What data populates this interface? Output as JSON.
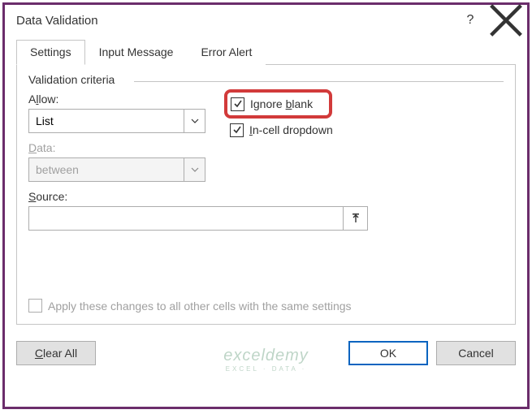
{
  "titlebar": {
    "title": "Data Validation"
  },
  "tabs": [
    {
      "label": "Settings",
      "active": true
    },
    {
      "label": "Input Message",
      "active": false
    },
    {
      "label": "Error Alert",
      "active": false
    }
  ],
  "criteria": {
    "legend": "Validation criteria",
    "allow": {
      "label_pre": "A",
      "label_u": "l",
      "label_post": "low:",
      "value": "List"
    },
    "data": {
      "label_pre": "",
      "label_u": "D",
      "label_post": "ata:",
      "value": "between",
      "disabled": true
    },
    "source": {
      "label_pre": "",
      "label_u": "S",
      "label_post": "ource:",
      "value": ""
    },
    "ignore_blank": {
      "label_pre": "Ignore ",
      "label_u": "b",
      "label_post": "lank",
      "checked": true
    },
    "incell_dropdown": {
      "label_pre": "",
      "label_u": "I",
      "label_post": "n-cell dropdown",
      "checked": true
    },
    "apply_all": {
      "label_pre": "Apply these changes to all other cells with the same settings",
      "checked": false
    }
  },
  "buttons": {
    "clear_all": "Clear All",
    "clear_u": "C",
    "clear_post": "lear All",
    "ok": "OK",
    "cancel": "Cancel"
  },
  "watermark": {
    "line1": "exceldemy",
    "line2": "EXCEL · DATA ·"
  }
}
